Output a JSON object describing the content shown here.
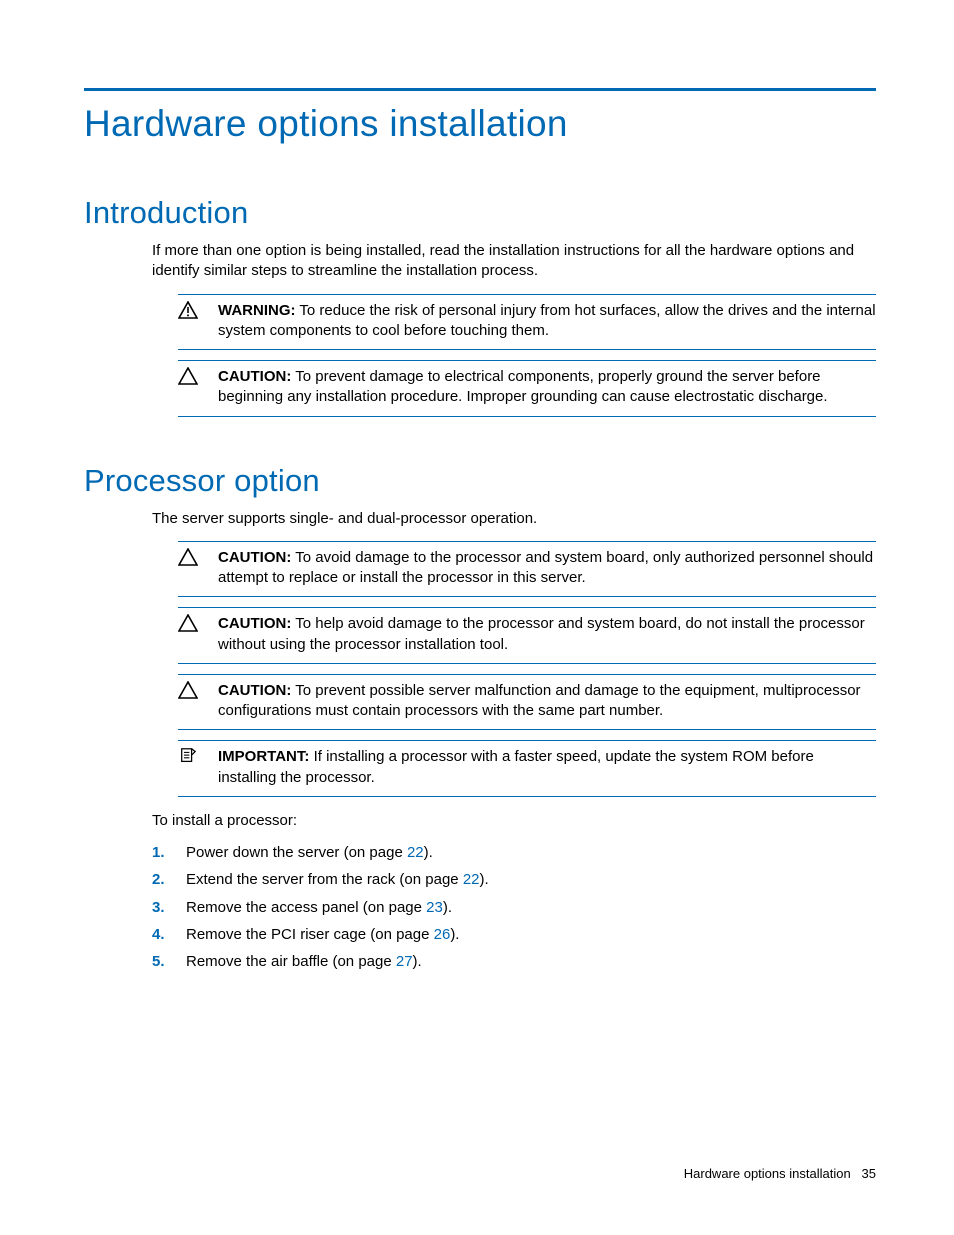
{
  "page_title": "Hardware options installation",
  "section_intro": {
    "title": "Introduction",
    "body": "If more than one option is being installed, read the installation instructions for all the hardware options and identify similar steps to streamline the installation process.",
    "callouts": [
      {
        "label": "WARNING:",
        "text": "To reduce the risk of personal injury from hot surfaces, allow the drives and the internal system components to cool before touching them.",
        "icon": "warning-exclaim"
      },
      {
        "label": "CAUTION:",
        "text": "To prevent damage to electrical components, properly ground the server before beginning any installation procedure. Improper grounding can cause electrostatic discharge.",
        "icon": "caution"
      }
    ]
  },
  "section_processor": {
    "title": "Processor option",
    "body": "The server supports single- and dual-processor operation.",
    "callouts": [
      {
        "label": "CAUTION:",
        "text": "To avoid damage to the processor and system board, only authorized personnel should attempt to replace or install the processor in this server.",
        "icon": "caution"
      },
      {
        "label": "CAUTION:",
        "text": "To help avoid damage to the processor and system board, do not install the processor without using the processor installation tool.",
        "icon": "caution"
      },
      {
        "label": "CAUTION:",
        "text": "To prevent possible server malfunction and damage to the equipment, multiprocessor configurations must contain processors with the same part number.",
        "icon": "caution"
      },
      {
        "label": "IMPORTANT:",
        "text": "If installing a processor with a faster speed, update the system ROM before installing the processor.",
        "icon": "important"
      }
    ],
    "steps_lead": "To install a processor:",
    "steps": [
      {
        "num": "1.",
        "pre": "Power down the server (on page ",
        "page": "22",
        "post": ")."
      },
      {
        "num": "2.",
        "pre": "Extend the server from the rack (on page ",
        "page": "22",
        "post": ")."
      },
      {
        "num": "3.",
        "pre": "Remove the access panel (on page ",
        "page": "23",
        "post": ")."
      },
      {
        "num": "4.",
        "pre": "Remove the PCI riser cage (on page ",
        "page": "26",
        "post": ")."
      },
      {
        "num": "5.",
        "pre": "Remove the air baffle (on page ",
        "page": "27",
        "post": ")."
      }
    ]
  },
  "footer": {
    "title": "Hardware options installation",
    "page_num": "35"
  }
}
